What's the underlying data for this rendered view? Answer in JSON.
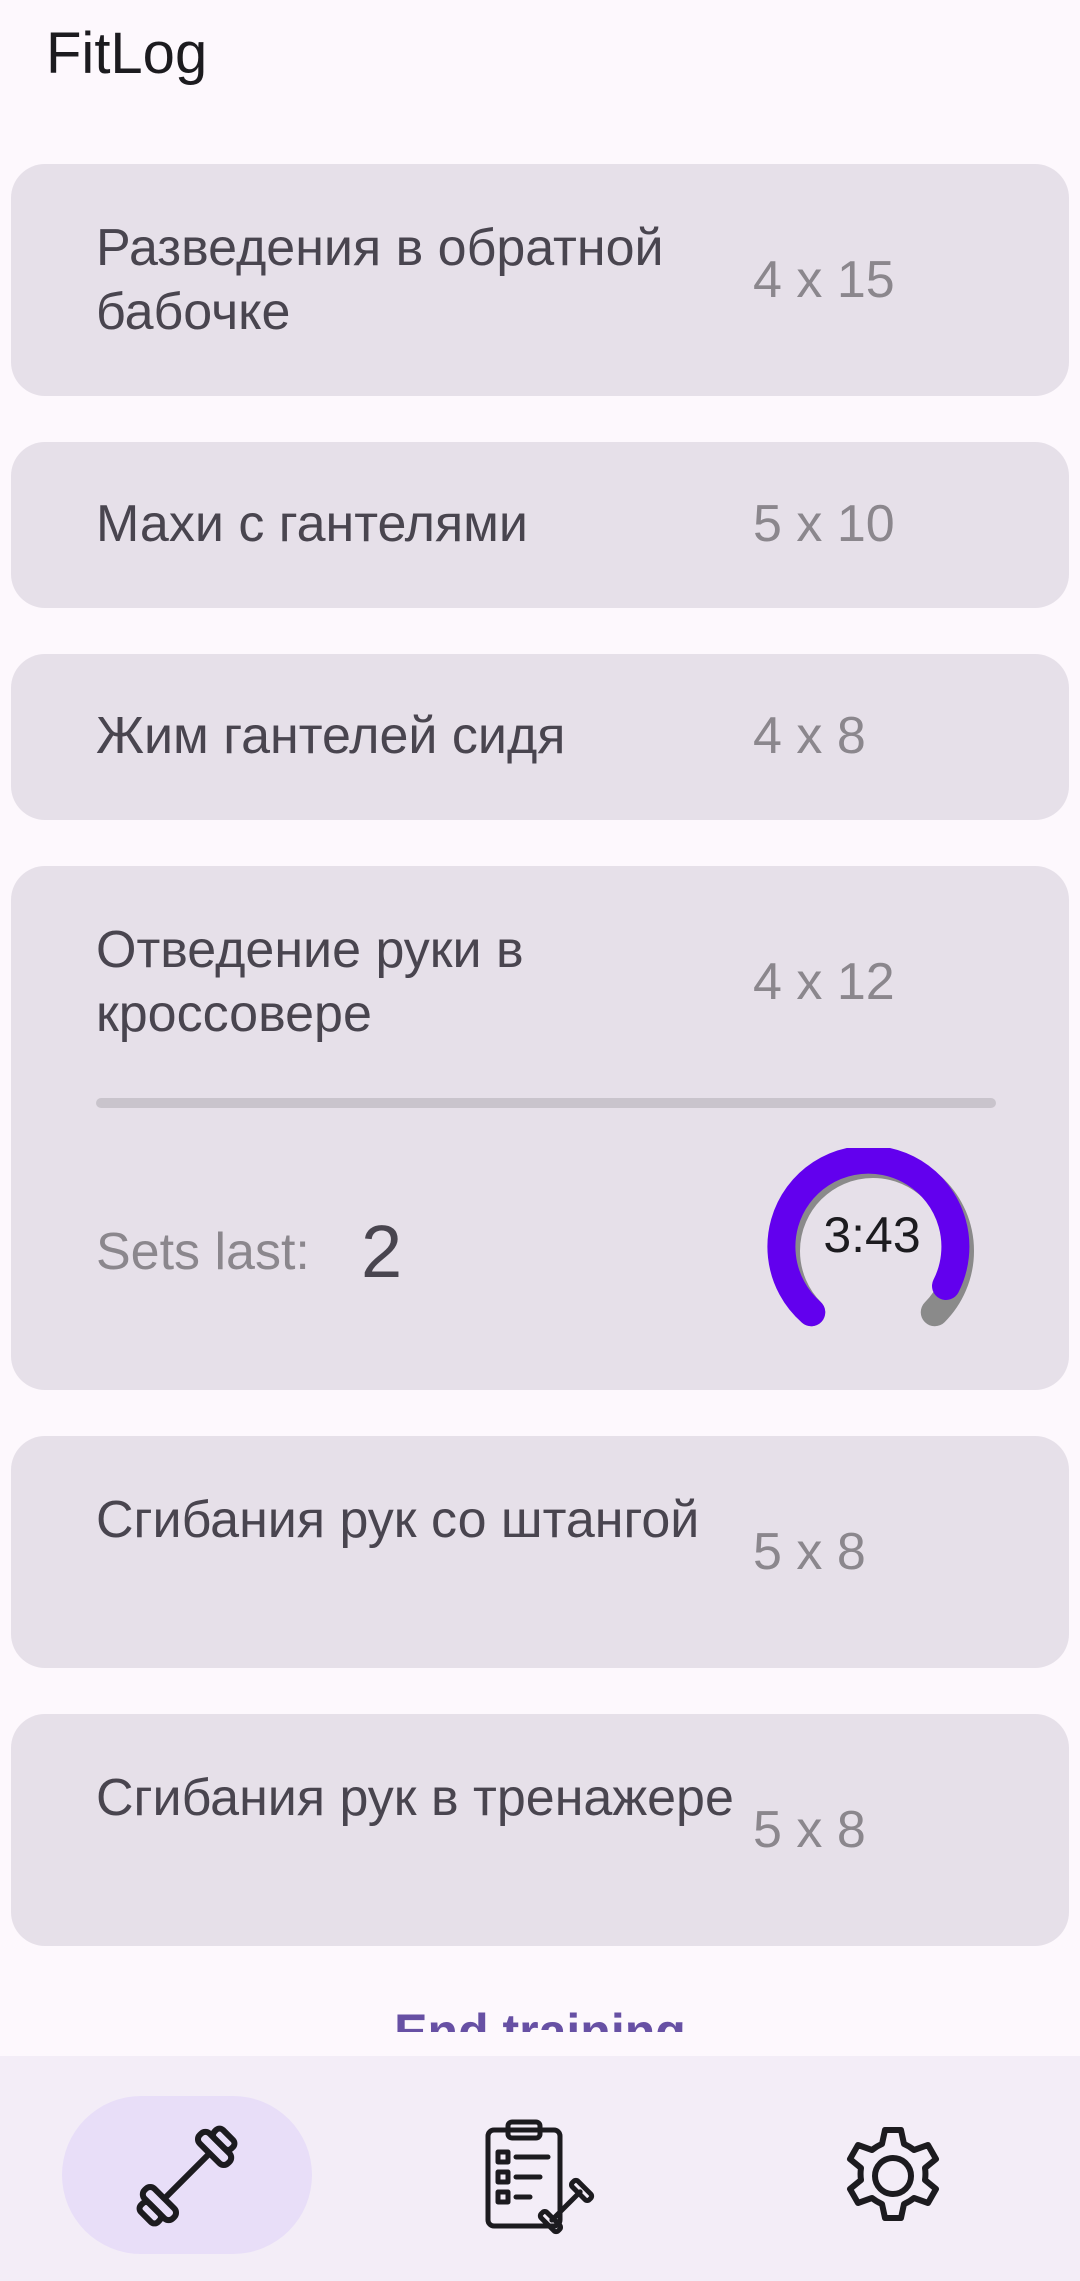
{
  "app": {
    "title": "FitLog"
  },
  "exercises": [
    {
      "name": "Разведения в обратной бабочке",
      "sets": "4 x 15"
    },
    {
      "name": "Махи с гантелями",
      "sets": "5 x 10"
    },
    {
      "name": "Жим гантелей сидя",
      "sets": "4 x 8"
    },
    {
      "name": "Отведение руки в кроссовере",
      "sets": "4 x 12"
    },
    {
      "name": "Сгибания рук со штангой",
      "sets": "5 x 8"
    },
    {
      "name": "Сгибания рук в тренажере",
      "sets": "5 x 8"
    }
  ],
  "active_exercise": {
    "sets_last_label": "Sets last:",
    "sets_last_value": "2",
    "timer": "3:43"
  },
  "end_training_label": "End training",
  "bottom_nav": {
    "items": [
      {
        "icon": "dumbbell-icon",
        "selected": true
      },
      {
        "icon": "workout-plan-icon",
        "selected": false
      },
      {
        "icon": "gear-icon",
        "selected": false
      }
    ]
  },
  "colors": {
    "accent": "#6200ee",
    "card": "#e6e0e9",
    "nav_selected": "#e8def8"
  }
}
